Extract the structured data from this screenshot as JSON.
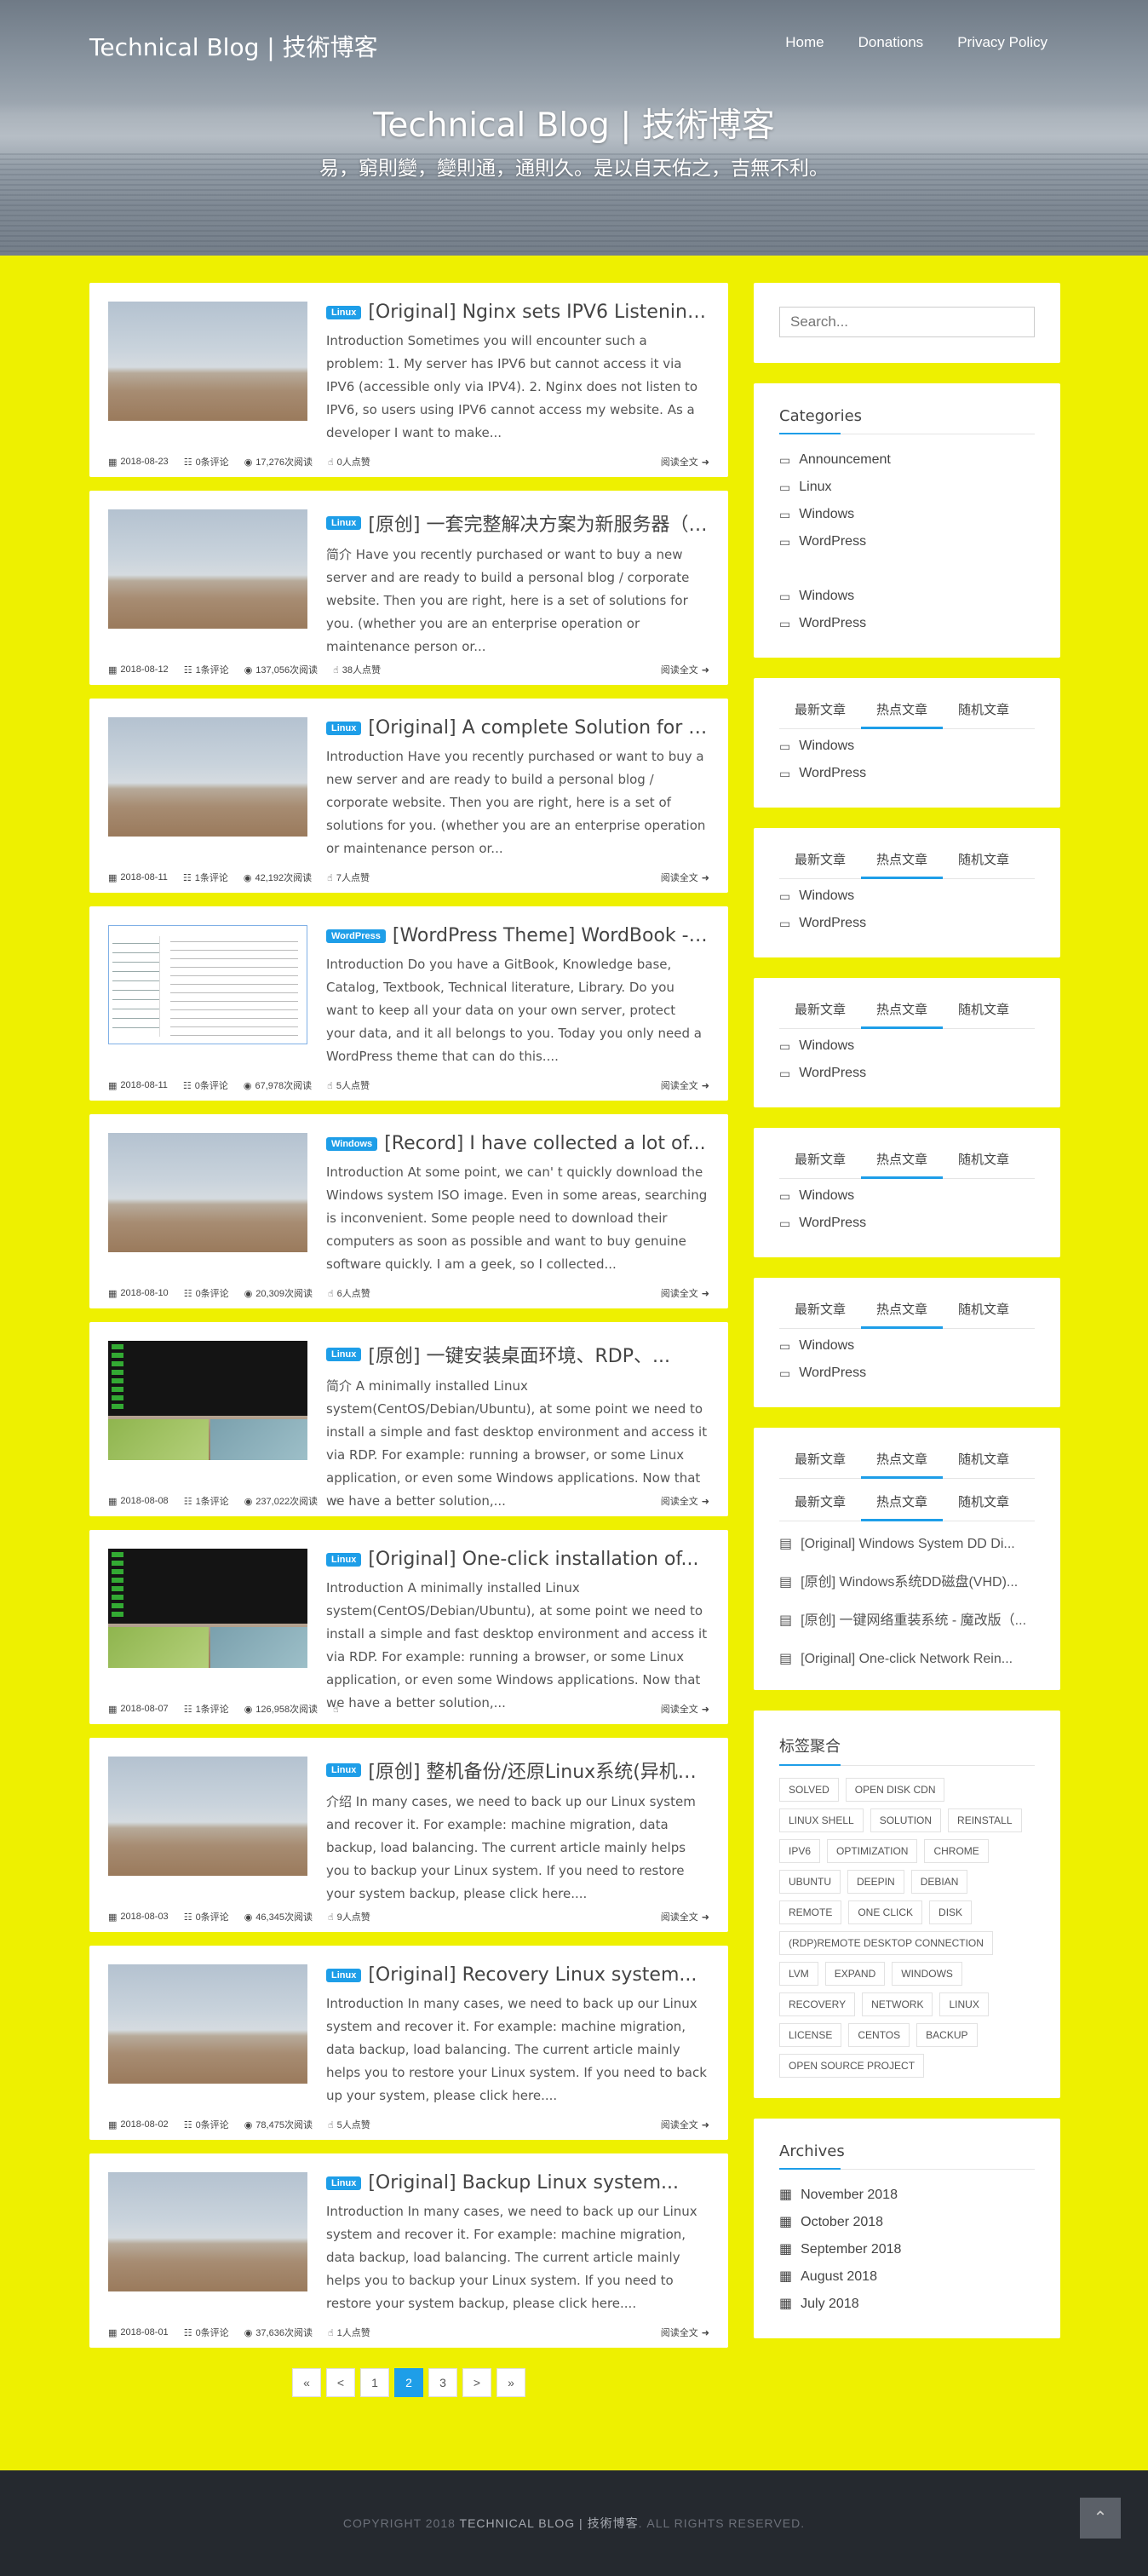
{
  "header": {
    "brand": "Technical Blog | 技術博客",
    "nav": [
      "Home",
      "Donations",
      "Privacy Policy"
    ],
    "title": "Technical Blog | 技術博客",
    "subtitle": "易，窮則變，變則通，通則久。是以自天佑之，吉無不利。"
  },
  "posts": [
    {
      "badge": "Linux",
      "title": "[Original] Nginx sets IPV6 Listening...",
      "excerpt": "Introduction Sometimes you will encounter such a problem: 1. My server has IPV6 but cannot access it via IPV6 (accessible only via IPV4). 2. Nginx does not listen to IPV6, so users using IPV6 cannot access my website. As a developer I want to make...",
      "date": "2018-08-23",
      "comments": "0条评论",
      "views": "17,276次阅读",
      "likes": "0人点赞",
      "read": "阅读全文",
      "thumb": "landscape"
    },
    {
      "badge": "Linux",
      "title": "[原创] 一套完整解决方案为新服务器（系...",
      "excerpt": "简介 Have you recently purchased or want to buy a new server and are ready to build a personal blog / corporate website. Then you are right, here is a set of solutions for you. (whether you are an enterprise operation or maintenance person or...",
      "date": "2018-08-12",
      "comments": "1条评论",
      "views": "137,056次阅读",
      "likes": "38人点赞",
      "read": "阅读全文",
      "thumb": "landscape"
    },
    {
      "badge": "Linux",
      "title": "[Original] A complete Solution for ne...",
      "excerpt": "Introduction Have you recently purchased or want to buy a new server and are ready to build a personal blog / corporate website. Then you are right, here is a set of solutions for you. (whether you are an enterprise operation or maintenance person or...",
      "date": "2018-08-11",
      "comments": "1条评论",
      "views": "42,192次阅读",
      "likes": "7人点赞",
      "read": "阅读全文",
      "thumb": "landscape"
    },
    {
      "badge": "WordPress",
      "title": "[WordPress Theme] WordBook - A...",
      "excerpt": "Introduction Do you have a GitBook, Knowledge base, Catalog, Textbook, Technical literature, Library. Do you want to keep all your data on your own server, protect your data, and it all belongs to you. Today you only need a WordPress theme that can do this....",
      "date": "2018-08-11",
      "comments": "0条评论",
      "views": "67,978次阅读",
      "likes": "5人点赞",
      "read": "阅读全文",
      "thumb": "doc"
    },
    {
      "badge": "Windows",
      "title": "[Record] I have collected a lot of...",
      "excerpt": "Introduction At some point, we can' t quickly download the Windows system ISO image. Even in some areas, searching is inconvenient. Some people need to download their computers as soon as possible and want to buy genuine software quickly. I am a geek, so I collected...",
      "date": "2018-08-10",
      "comments": "0条评论",
      "views": "20,309次阅读",
      "likes": "6人点赞",
      "read": "阅读全文",
      "thumb": "landscape"
    },
    {
      "badge": "Linux",
      "title": "[原创] 一键安装桌面环境、RDP、...",
      "excerpt": "简介 A minimally installed Linux system(CentOS/Debian/Ubuntu), at some point we need to install a simple and fast desktop environment and access it via RDP. For example: running a browser, or some Linux application, or even some Windows applications. Now that we have a better solution,...",
      "date": "2018-08-08",
      "comments": "1条评论",
      "views": "237,022次阅读",
      "likes": "",
      "read": "阅读全文",
      "thumb": "desk"
    },
    {
      "badge": "Linux",
      "title": "[Original] One-click installation of...",
      "excerpt": "Introduction A minimally installed Linux system(CentOS/Debian/Ubuntu), at some point we need to install a simple and fast desktop environment and access it via RDP. For example: running a browser, or some Linux application, or even some Windows applications. Now that we have a better solution,...",
      "date": "2018-08-07",
      "comments": "1条评论",
      "views": "126,958次阅读",
      "likes": "",
      "read": "阅读全文",
      "thumb": "desk"
    },
    {
      "badge": "Linux",
      "title": "[原创] 整机备份/还原Linux系统(异机迁...",
      "excerpt": "介绍 In many cases, we need to back up our Linux system and recover it. For example: machine migration, data backup, load balancing. The current article mainly helps you to backup your Linux system. If you need to restore your system backup, please click here....",
      "date": "2018-08-03",
      "comments": "0条评论",
      "views": "46,345次阅读",
      "likes": "9人点赞",
      "read": "阅读全文",
      "thumb": "landscape"
    },
    {
      "badge": "Linux",
      "title": "[Original] Recovery Linux system...",
      "excerpt": "Introduction In many cases, we need to back up our Linux system and recover it. For example: machine migration, data backup, load balancing. The current article mainly helps you to restore your Linux system. If you need to back up your system, please click here....",
      "date": "2018-08-02",
      "comments": "0条评论",
      "views": "78,475次阅读",
      "likes": "5人点赞",
      "read": "阅读全文",
      "thumb": "landscape"
    },
    {
      "badge": "Linux",
      "title": "[Original] Backup Linux system...",
      "excerpt": "Introduction In many cases, we need to back up our Linux system and recover it. For example: machine migration, data backup, load balancing. The current article mainly helps you to backup your Linux system. If you need to restore your system backup, please click here....",
      "date": "2018-08-01",
      "comments": "0条评论",
      "views": "37,636次阅读",
      "likes": "1人点赞",
      "read": "阅读全文",
      "thumb": "landscape"
    }
  ],
  "pagination": [
    "«",
    "<",
    "1",
    "2",
    "3",
    ">",
    "»"
  ],
  "pagination_active": "2",
  "sidebar": {
    "search_placeholder": "Search...",
    "categories_title": "Categories",
    "categories": [
      "Announcement",
      "Linux",
      "Windows",
      "WordPress"
    ],
    "categories_extra": [
      "Windows",
      "WordPress"
    ],
    "tabs": [
      "最新文章",
      "热点文章",
      "随机文章"
    ],
    "tab_items": [
      "Windows",
      "WordPress"
    ],
    "articles": [
      "[Original] Windows System DD Di...",
      "[原创] Windows系统DD磁盘(VHD)...",
      "[原创] 一键网络重装系统 - 魔改版（...",
      "[Original] One-click Network Rein..."
    ],
    "tags_title": "标签聚合",
    "tags": [
      "SOLVED",
      "OPEN DISK CDN",
      "LINUX SHELL",
      "SOLUTION",
      "REINSTALL",
      "IPV6",
      "OPTIMIZATION",
      "CHROME",
      "UBUNTU",
      "DEEPIN",
      "DEBIAN",
      "REMOTE",
      "ONE CLICK",
      "DISK",
      "(RDP)REMOTE DESKTOP CONNECTION",
      "LVM",
      "EXPAND",
      "WINDOWS",
      "RECOVERY",
      "NETWORK",
      "LINUX",
      "LICENSE",
      "CENTOS",
      "BACKUP",
      "OPEN SOURCE PROJECT"
    ],
    "archives_title": "Archives",
    "archives": [
      "November 2018",
      "October 2018",
      "September 2018",
      "August 2018",
      "July 2018"
    ]
  },
  "footer": {
    "prefix": "COPYRIGHT 2018 ",
    "site": "TECHNICAL BLOG | 技術博客",
    "suffix": ". ALL RIGHTS RESERVED."
  },
  "colors": {
    "accent": "#1e9ee8",
    "page_bg": "#eef000",
    "footer_bg": "#25292f"
  }
}
